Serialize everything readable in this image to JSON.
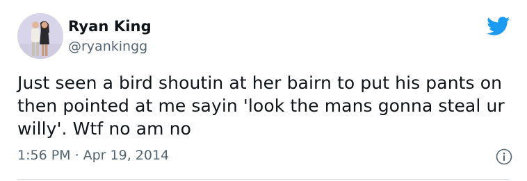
{
  "author": {
    "display_name": "Ryan King",
    "handle": "@ryankingg"
  },
  "tweet": {
    "text": "Just seen a bird shoutin at her bairn to put his pants on then pointed at me sayin 'look the mans gonna steal ur willy'. Wtf no am no",
    "time": "1:56 PM",
    "separator": "·",
    "date": "Apr 19, 2014"
  },
  "icons": {
    "logo": "twitter-bird-icon",
    "info": "info-icon"
  },
  "colors": {
    "text": "#0f1419",
    "secondary_text": "#536471",
    "twitter_blue": "#1d9bf0",
    "divider": "#cfd9de"
  }
}
